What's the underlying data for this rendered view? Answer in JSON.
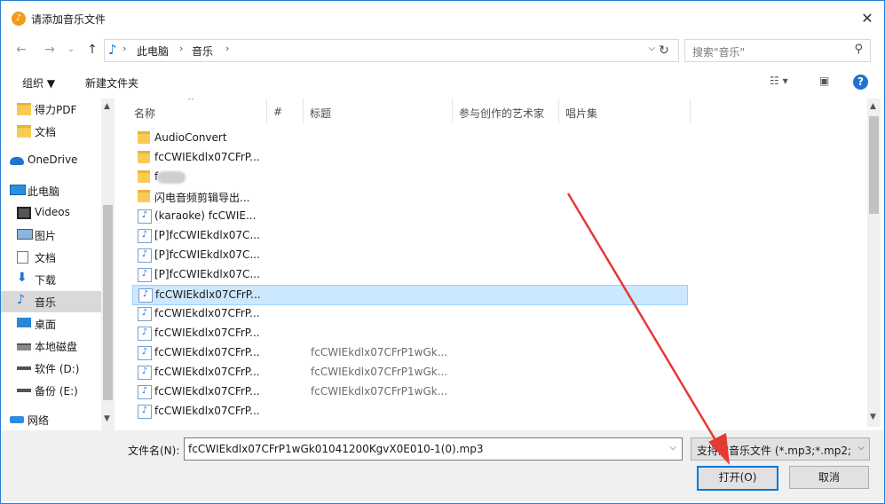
{
  "window": {
    "title": "请添加音乐文件",
    "close_glyph": "✕"
  },
  "nav": {
    "back": "←",
    "forward": "→",
    "recent": "⌄",
    "up": "↑",
    "breadcrumbs": [
      "此电脑",
      "音乐"
    ],
    "refresh": "↻",
    "search_placeholder": "搜索\"音乐\""
  },
  "toolbar": {
    "organize": "组织 ▼",
    "new_folder": "新建文件夹",
    "help": "?"
  },
  "sidebar": {
    "items": [
      {
        "label": "得力PDF",
        "icon": "folder-icon"
      },
      {
        "label": "文档",
        "icon": "folder-icon"
      },
      {
        "label": "OneDrive",
        "icon": "cloud-icon"
      },
      {
        "label": "此电脑",
        "icon": "computer-icon"
      },
      {
        "label": "Videos",
        "icon": "video-icon"
      },
      {
        "label": "图片",
        "icon": "picture-icon"
      },
      {
        "label": "文档",
        "icon": "document-icon"
      },
      {
        "label": "下载",
        "icon": "download-icon"
      },
      {
        "label": "音乐",
        "icon": "music-icon"
      },
      {
        "label": "桌面",
        "icon": "desktop-icon"
      },
      {
        "label": "本地磁盘",
        "icon": "disk-icon"
      },
      {
        "label": "软件 (D:)",
        "icon": "drive-icon"
      },
      {
        "label": "备份 (E:)",
        "icon": "drive-icon"
      },
      {
        "label": "网络",
        "icon": "network-icon"
      }
    ],
    "selected_index": 8
  },
  "columns": {
    "name": "名称",
    "number": "#",
    "title": "标题",
    "artist": "参与创作的艺术家",
    "album": "唱片集"
  },
  "files": [
    {
      "name": "AudioConvert",
      "type": "folder",
      "title": ""
    },
    {
      "name": "fcCWIEkdlx07CFrP...",
      "type": "folder",
      "title": ""
    },
    {
      "name": "f",
      "type": "folder",
      "title": ""
    },
    {
      "name": "闪电音频剪辑导出...",
      "type": "folder",
      "title": ""
    },
    {
      "name": "(karaoke) fcCWIE...",
      "type": "audio",
      "title": ""
    },
    {
      "name": "[P]fcCWIEkdlx07C...",
      "type": "audio",
      "title": ""
    },
    {
      "name": "[P]fcCWIEkdlx07C...",
      "type": "audio",
      "title": ""
    },
    {
      "name": "[P]fcCWIEkdlx07C...",
      "type": "audio",
      "title": ""
    },
    {
      "name": "fcCWIEkdlx07CFrP...",
      "type": "audio",
      "title": ""
    },
    {
      "name": "fcCWIEkdlx07CFrP...",
      "type": "audio",
      "title": ""
    },
    {
      "name": "fcCWIEkdlx07CFrP...",
      "type": "audio",
      "title": ""
    },
    {
      "name": "fcCWIEkdlx07CFrP...",
      "type": "audio",
      "title": "fcCWIEkdlx07CFrP1wGk..."
    },
    {
      "name": "fcCWIEkdlx07CFrP...",
      "type": "audio",
      "title": "fcCWIEkdlx07CFrP1wGk..."
    },
    {
      "name": "fcCWIEkdlx07CFrP...",
      "type": "audio",
      "title": "fcCWIEkdlx07CFrP1wGk..."
    },
    {
      "name": "fcCWIEkdlx07CFrP...",
      "type": "audio",
      "title": ""
    }
  ],
  "selected_file_index": 8,
  "bottom": {
    "filename_label": "文件名(N):",
    "filename_value": "fcCWIEkdlx07CFrP1wGk01041200KgvX0E010-1(0).mp3",
    "filetype_value": "支持的音乐文件 (*.mp3;*.mp2;",
    "open_label": "打开(O)",
    "cancel_label": "取消"
  },
  "colors": {
    "accent": "#0078d7",
    "selection": "#cce8ff",
    "annotation_arrow": "#e53935"
  }
}
